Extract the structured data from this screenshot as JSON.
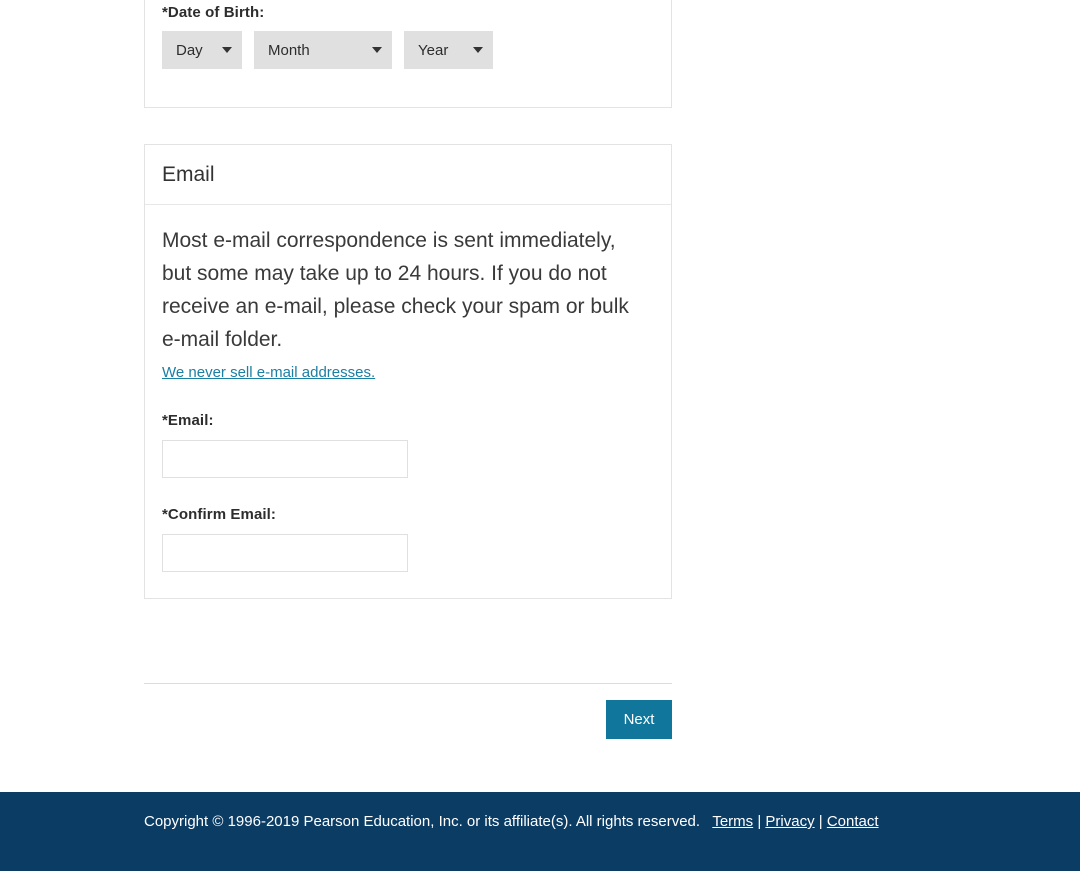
{
  "dob_section": {
    "label": "*Date of Birth:",
    "selects": [
      {
        "name": "day",
        "value": "Day"
      },
      {
        "name": "month",
        "value": "Month"
      },
      {
        "name": "year",
        "value": "Year"
      }
    ]
  },
  "email_section": {
    "heading": "Email",
    "intro": "Most e-mail correspondence is sent immediately, but some may take up to 24 hours. If you do not receive an e-mail, please check your spam or bulk e-mail folder.",
    "privacy_link": "We never sell e-mail addresses.",
    "email_label": "*Email:",
    "email_value": "",
    "email_placeholder": "",
    "confirm_label": "*Confirm Email:",
    "confirm_value": "",
    "confirm_placeholder": ""
  },
  "actions": {
    "next_label": "Next"
  },
  "footer": {
    "copyright": "Copyright © 1996-2019 Pearson Education, Inc. or its affiliate(s). All rights reserved.",
    "terms": "Terms",
    "privacy": "Privacy",
    "contact": "Contact",
    "separator": "|"
  },
  "colors": {
    "accent": "#10769c",
    "link": "#1b7fa4",
    "footer_bg": "#0b3c64",
    "select_bg": "#e0e0e0",
    "panel_border": "#e3e3e3"
  }
}
